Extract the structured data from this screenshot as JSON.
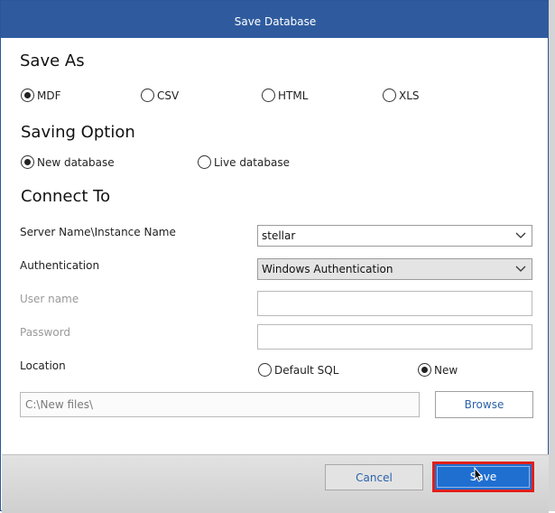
{
  "window": {
    "title": "Save Database"
  },
  "save_as": {
    "heading": "Save As",
    "options": [
      {
        "label": "MDF",
        "checked": true
      },
      {
        "label": "CSV",
        "checked": false
      },
      {
        "label": "HTML",
        "checked": false
      },
      {
        "label": "XLS",
        "checked": false
      }
    ]
  },
  "saving_option": {
    "heading": "Saving Option",
    "options": [
      {
        "label": "New database",
        "checked": true
      },
      {
        "label": "Live database",
        "checked": false
      }
    ]
  },
  "connect_to": {
    "heading": "Connect To",
    "server_label": "Server Name\\Instance Name",
    "server_value": "stellar",
    "auth_label": "Authentication",
    "auth_value": "Windows Authentication",
    "username_label": "User name",
    "username_value": "",
    "password_label": "Password",
    "password_value": ""
  },
  "location": {
    "label": "Location",
    "options": [
      {
        "label": "Default SQL",
        "checked": false
      },
      {
        "label": "New",
        "checked": true
      }
    ],
    "path_value": "C:\\New files\\",
    "browse_label": "Browse"
  },
  "footer": {
    "cancel_label": "Cancel",
    "save_label": "Save"
  },
  "colors": {
    "titlebar": "#2f5b9e",
    "save_button": "#1f6fd1",
    "highlight_border": "#e0201a",
    "link_text": "#2b63a8"
  }
}
